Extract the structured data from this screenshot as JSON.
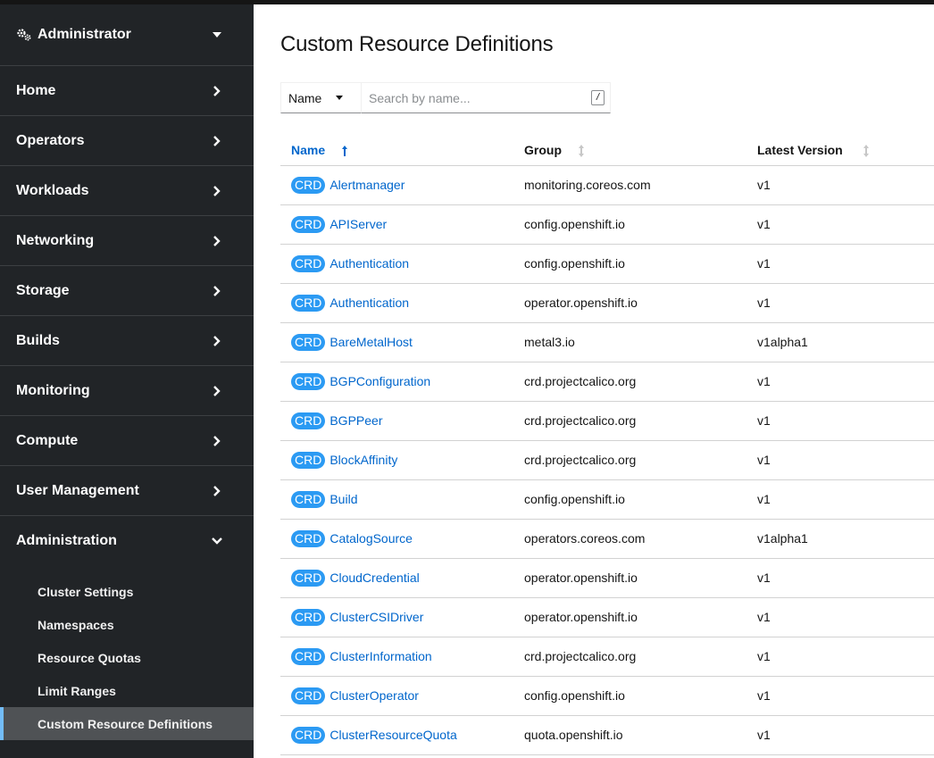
{
  "perspective": {
    "label": "Administrator",
    "icon": "cogs-icon"
  },
  "nav": [
    {
      "label": "Home",
      "expanded": false
    },
    {
      "label": "Operators",
      "expanded": false
    },
    {
      "label": "Workloads",
      "expanded": false
    },
    {
      "label": "Networking",
      "expanded": false
    },
    {
      "label": "Storage",
      "expanded": false
    },
    {
      "label": "Builds",
      "expanded": false
    },
    {
      "label": "Monitoring",
      "expanded": false
    },
    {
      "label": "Compute",
      "expanded": false
    },
    {
      "label": "User Management",
      "expanded": false
    },
    {
      "label": "Administration",
      "expanded": true
    }
  ],
  "subnav": [
    {
      "label": "Cluster Settings",
      "active": false
    },
    {
      "label": "Namespaces",
      "active": false
    },
    {
      "label": "Resource Quotas",
      "active": false
    },
    {
      "label": "Limit Ranges",
      "active": false
    },
    {
      "label": "Custom Resource Definitions",
      "active": true
    }
  ],
  "page": {
    "title": "Custom Resource Definitions"
  },
  "filter": {
    "dropdown_label": "Name",
    "search_placeholder": "Search by name...",
    "shortcut": "/"
  },
  "table": {
    "columns": [
      "Name",
      "Group",
      "Latest Version"
    ],
    "badge": "CRD",
    "rows": [
      {
        "name": "Alertmanager",
        "group": "monitoring.coreos.com",
        "version": "v1"
      },
      {
        "name": "APIServer",
        "group": "config.openshift.io",
        "version": "v1"
      },
      {
        "name": "Authentication",
        "group": "config.openshift.io",
        "version": "v1"
      },
      {
        "name": "Authentication",
        "group": "operator.openshift.io",
        "version": "v1"
      },
      {
        "name": "BareMetalHost",
        "group": "metal3.io",
        "version": "v1alpha1"
      },
      {
        "name": "BGPConfiguration",
        "group": "crd.projectcalico.org",
        "version": "v1"
      },
      {
        "name": "BGPPeer",
        "group": "crd.projectcalico.org",
        "version": "v1"
      },
      {
        "name": "BlockAffinity",
        "group": "crd.projectcalico.org",
        "version": "v1"
      },
      {
        "name": "Build",
        "group": "config.openshift.io",
        "version": "v1"
      },
      {
        "name": "CatalogSource",
        "group": "operators.coreos.com",
        "version": "v1alpha1"
      },
      {
        "name": "CloudCredential",
        "group": "operator.openshift.io",
        "version": "v1"
      },
      {
        "name": "ClusterCSIDriver",
        "group": "operator.openshift.io",
        "version": "v1"
      },
      {
        "name": "ClusterInformation",
        "group": "crd.projectcalico.org",
        "version": "v1"
      },
      {
        "name": "ClusterOperator",
        "group": "config.openshift.io",
        "version": "v1"
      },
      {
        "name": "ClusterResourceQuota",
        "group": "quota.openshift.io",
        "version": "v1"
      }
    ]
  }
}
